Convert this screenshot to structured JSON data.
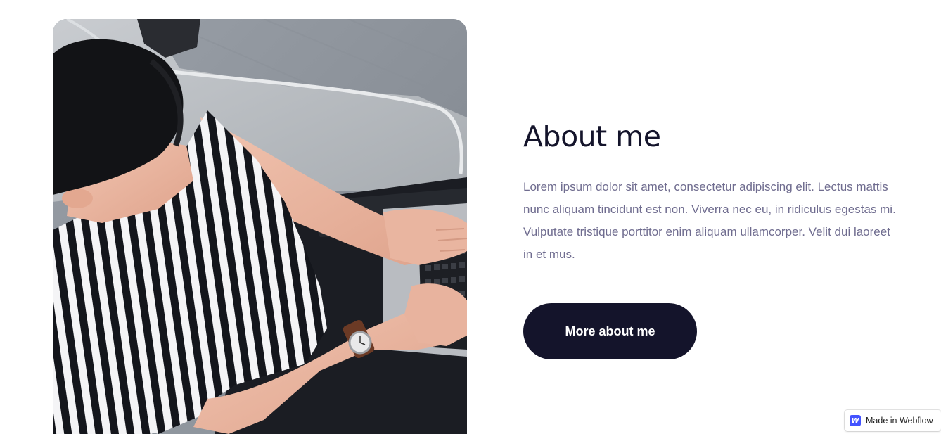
{
  "about": {
    "title": "About me",
    "paragraph": "Lorem ipsum dolor sit amet, consectetur adipiscing elit. Lectus mattis nunc aliquam tincidunt est non. Viverra nec eu, in ridiculus egestas mi. Vulputate tristique porttitor enim aliquam ullamcorper. Velit dui laoreet in et mus.",
    "button_label": "More about me",
    "photo_alt": "Man in striped t-shirt typing on a laptop, seen from above"
  },
  "badge": {
    "logo_letter": "W",
    "label": "Made in Webflow"
  },
  "colors": {
    "heading": "#14142b",
    "body_text": "#6f6c8f",
    "button_bg": "#14142b",
    "button_text": "#ffffff",
    "webflow_blue": "#4353ff"
  }
}
